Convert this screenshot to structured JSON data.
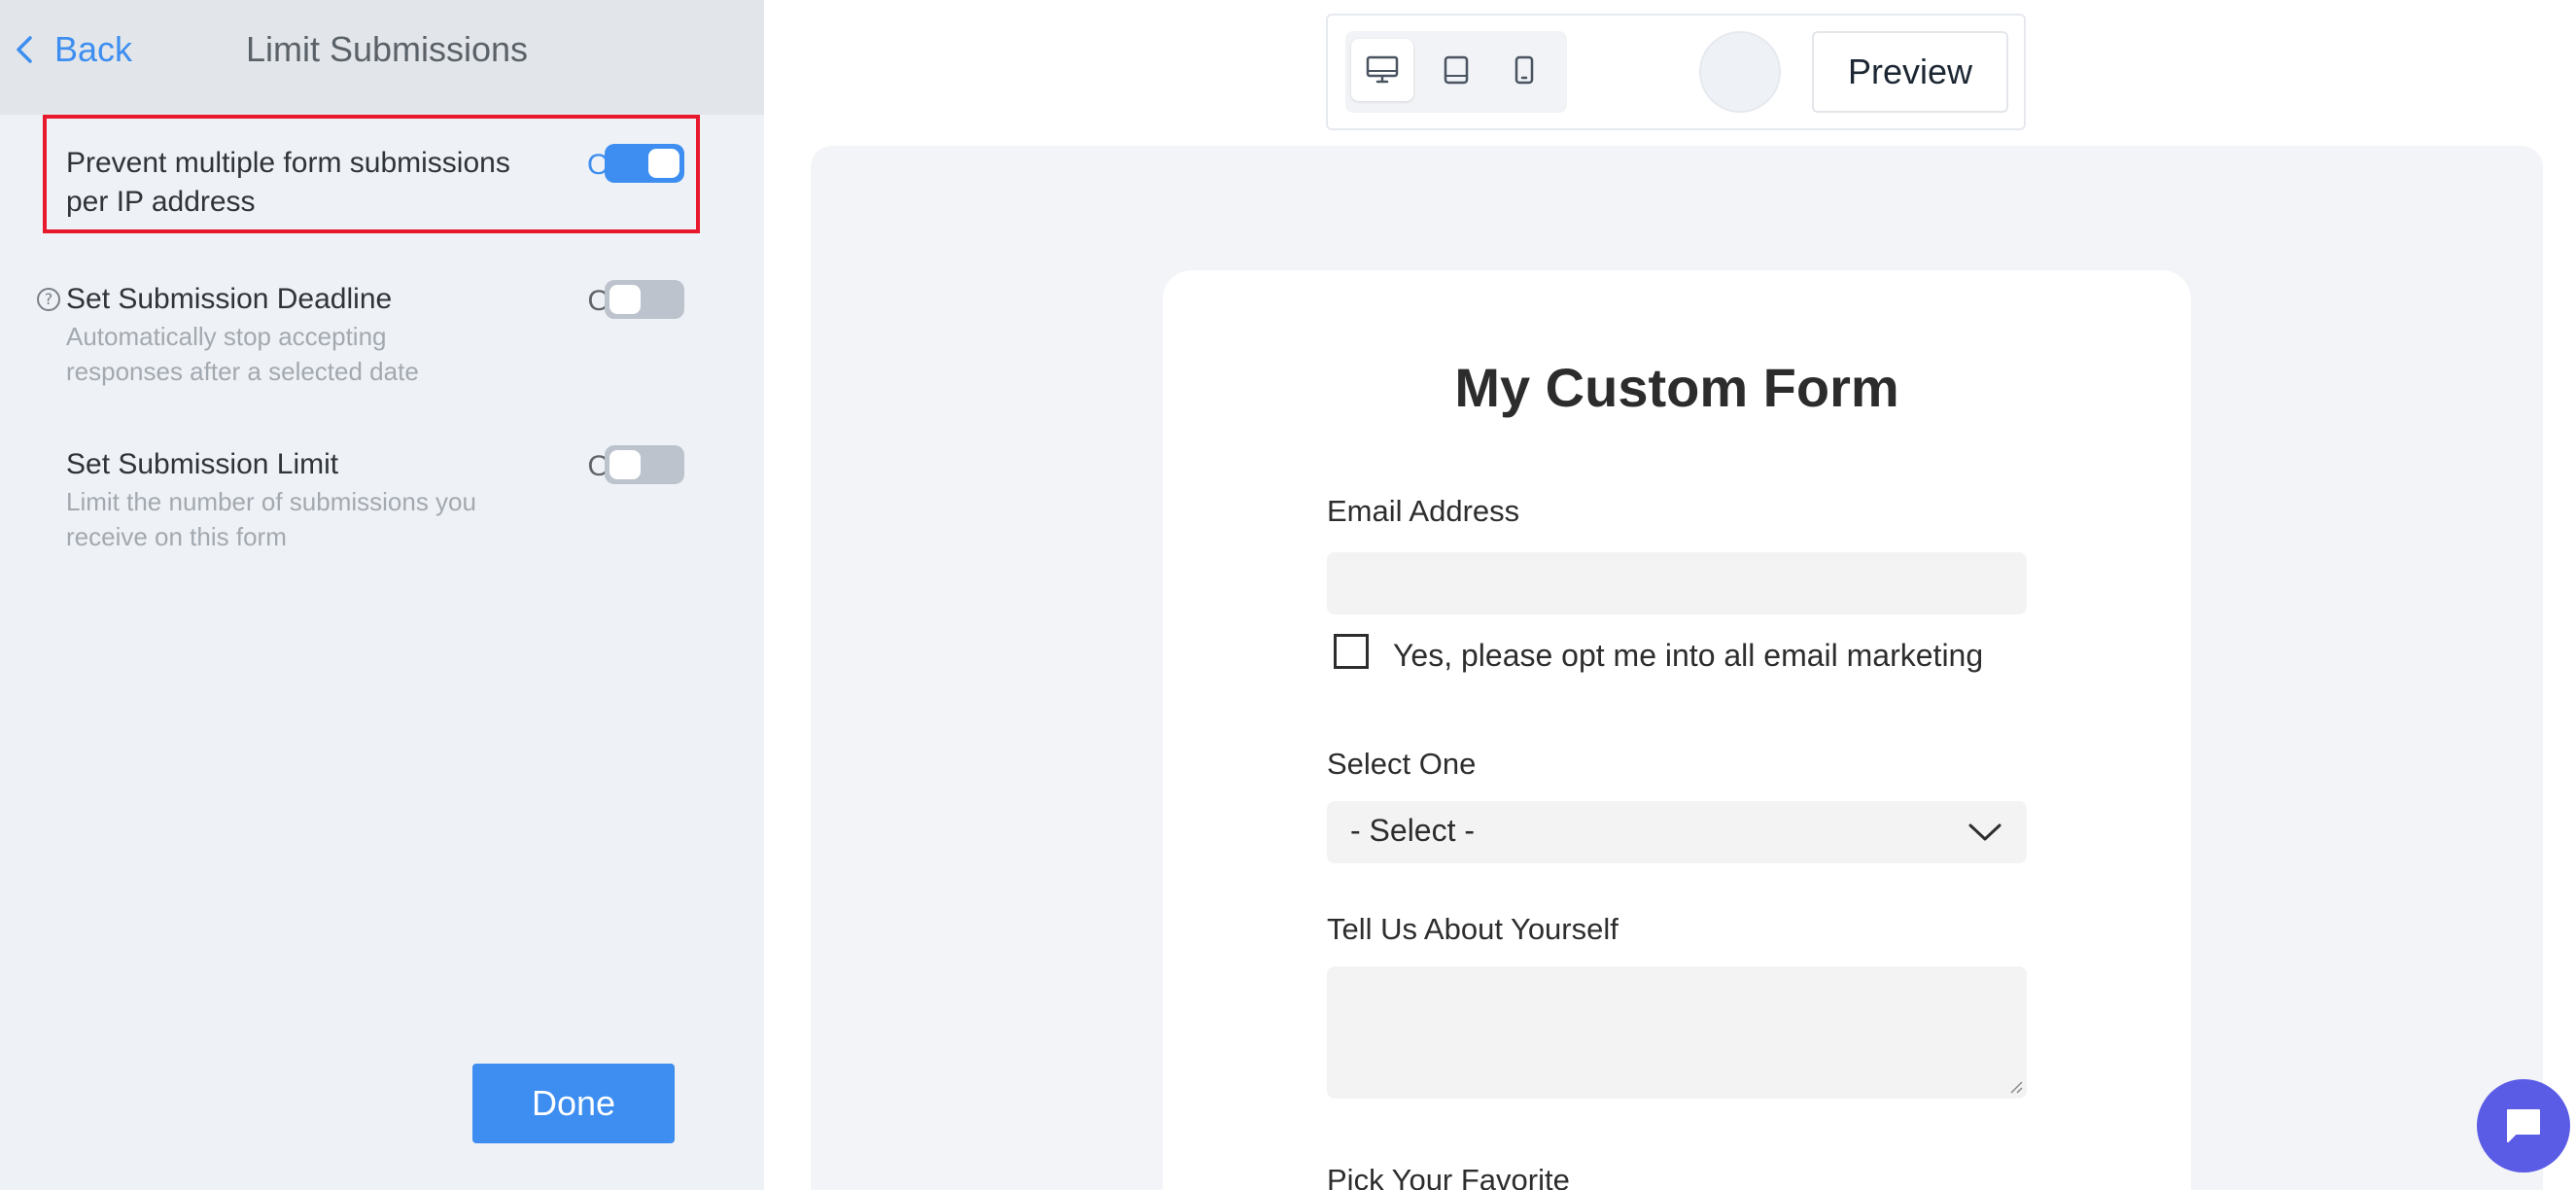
{
  "header": {
    "back_label": "Back",
    "title": "Limit Submissions"
  },
  "settings": [
    {
      "label": "Prevent multiple form submissions per IP address",
      "state": "On",
      "enabled": true
    },
    {
      "label": "Set Submission Deadline",
      "description": "Automatically stop accepting responses after a selected date",
      "state": "Off",
      "enabled": false
    },
    {
      "label": "Set Submission Limit",
      "description": "Limit the number of submissions you receive on this form",
      "state": "Off",
      "enabled": false
    }
  ],
  "done_label": "Done",
  "toolbar": {
    "devices": [
      "desktop-icon",
      "tablet-icon",
      "mobile-icon"
    ],
    "active_device": "desktop",
    "preview_label": "Preview"
  },
  "form": {
    "title": "My Custom Form",
    "email_label": "Email Address",
    "email_value": "",
    "optin_label": "Yes, please opt me into all email marketing",
    "select_label": "Select One",
    "select_value": "- Select -",
    "about_label": "Tell Us About Yourself",
    "about_value": "",
    "favorite_label": "Pick Your Favorite"
  },
  "colors": {
    "accent": "#3d8ef0",
    "highlight": "#e8192c",
    "chat": "#5b5ce6"
  }
}
